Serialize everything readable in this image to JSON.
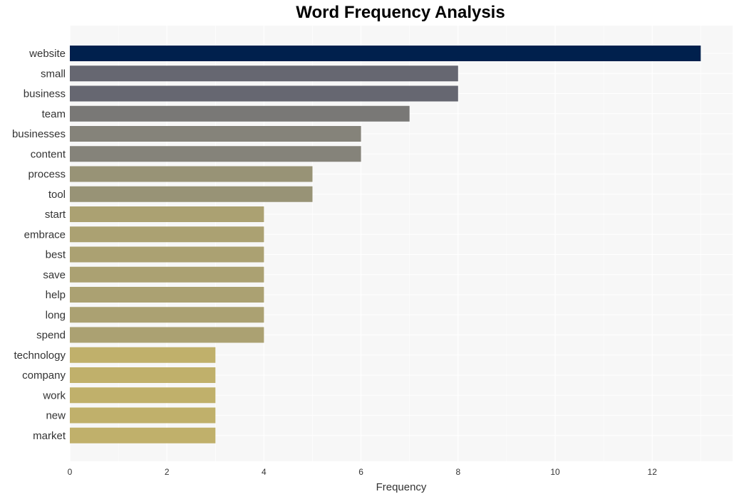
{
  "chart_data": {
    "type": "bar",
    "orientation": "horizontal",
    "title": "Word Frequency Analysis",
    "xlabel": "Frequency",
    "ylabel": "",
    "xlim": [
      0,
      13.6
    ],
    "xticks": [
      0,
      2,
      4,
      6,
      8,
      10,
      12
    ],
    "grid": true,
    "categories": [
      "website",
      "small",
      "business",
      "team",
      "businesses",
      "content",
      "process",
      "tool",
      "start",
      "embrace",
      "best",
      "save",
      "help",
      "long",
      "spend",
      "technology",
      "company",
      "work",
      "new",
      "market"
    ],
    "values": [
      13,
      8,
      8,
      7,
      6,
      6,
      5,
      5,
      4,
      4,
      4,
      4,
      4,
      4,
      4,
      3,
      3,
      3,
      3,
      3
    ],
    "colors": [
      "#00204d",
      "#666771",
      "#666771",
      "#797876",
      "#85837a",
      "#85837a",
      "#989376",
      "#989376",
      "#aba172",
      "#aba172",
      "#aba172",
      "#aba172",
      "#aba172",
      "#aba172",
      "#aba172",
      "#c0b06b",
      "#c0b06b",
      "#c0b06b",
      "#c0b06b",
      "#c0b06b"
    ]
  }
}
